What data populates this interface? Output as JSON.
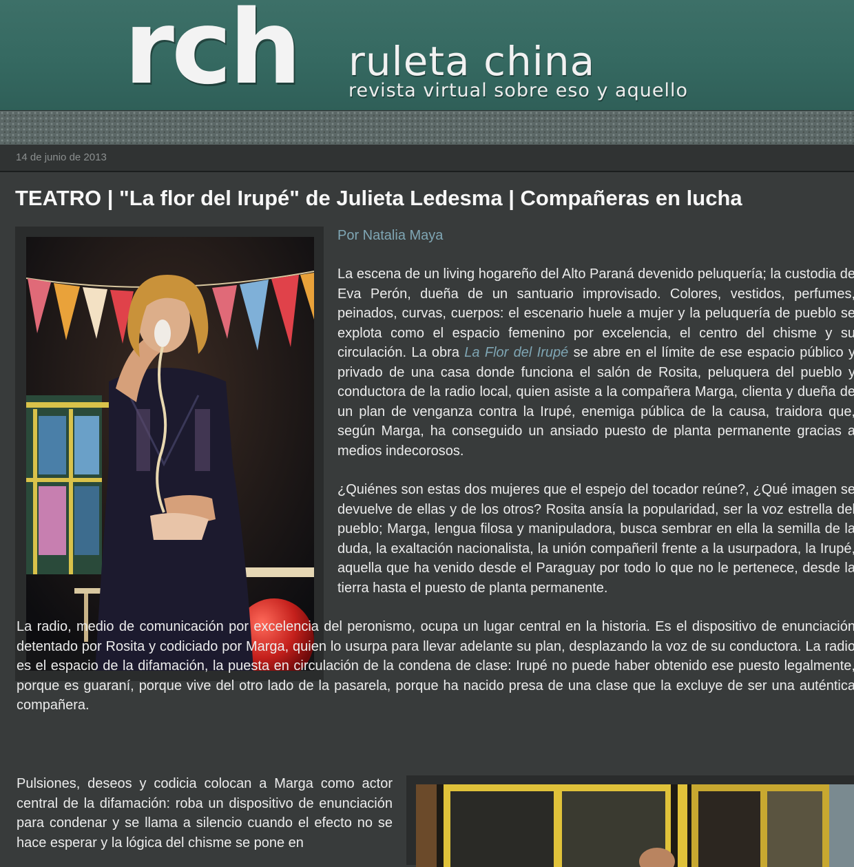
{
  "header": {
    "logo_mark": "rch",
    "site_name": "ruleta china",
    "tagline": "revista virtual sobre eso y aquello"
  },
  "post": {
    "date": "14 de junio de 2013",
    "title": "TEATRO | \"La flor del Irupé\" de Julieta Ledesma | Compañeras en lucha",
    "byline": "Por Natalia Maya",
    "paragraph_1": {
      "before_link": "La escena de un living hogareño del Alto Paraná devenido peluquería; la custodia de Eva Perón, dueña de un santuario improvisado. Colores, vestidos, perfumes, peinados, curvas, cuerpos: el escenario huele a mujer y la peluquería de pueblo se explota como el espacio femenino por excelencia, el centro del chisme y su circulación. La obra",
      "link_text": "La Flor del Irupé",
      "after_link": "se abre en el límite de ese espacio público y privado de una casa donde funciona el salón de Rosita, peluquera del pueblo y conductora de la radio local, quien asiste a la compañera Marga, clienta y dueña de un plan de venganza contra la Irupé, enemiga pública de la causa, traidora que, según Marga, ha conseguido un ansiado puesto de planta permanente gracias a medios indecorosos."
    },
    "paragraph_2": "¿Quiénes son estas dos mujeres que el espejo del tocador reúne?, ¿Qué imagen se devuelve de ellas y de los otros? Rosita ansía la popularidad, ser la voz estrella del pueblo; Marga, lengua filosa y manipuladora, busca sembrar en ella la semilla de la duda, la exaltación nacionalista, la unión compañeril frente a la usurpadora, la Irupé, aquella que ha venido desde el Paraguay por todo lo que no le pertenece, desde la tierra hasta el puesto de planta permanente.",
    "paragraph_3": "La radio, medio de comunicación por excelencia del peronismo, ocupa un lugar central en la historia. Es el dispositivo de enunciación detentado por Rosita y codiciado por Marga, quien lo usurpa para llevar adelante su plan, desplazando la voz de su conductora. La radio es el espacio de la difamación, la puesta en circulación de la condena de clase: Irupé no puede haber obtenido ese puesto legalmente, porque es guaraní, porque vive del otro lado de la pasarela, porque ha nacido presa de una clase que la excluye de ser una auténtica compañera.",
    "paragraph_4": "Pulsiones, deseos y codicia colocan a Marga como actor central de la difamación: roba un dispositivo de enunciación para condenar y se llama a silencio cuando el efecto no se hace esperar y la lógica del chisme se pone en"
  }
}
